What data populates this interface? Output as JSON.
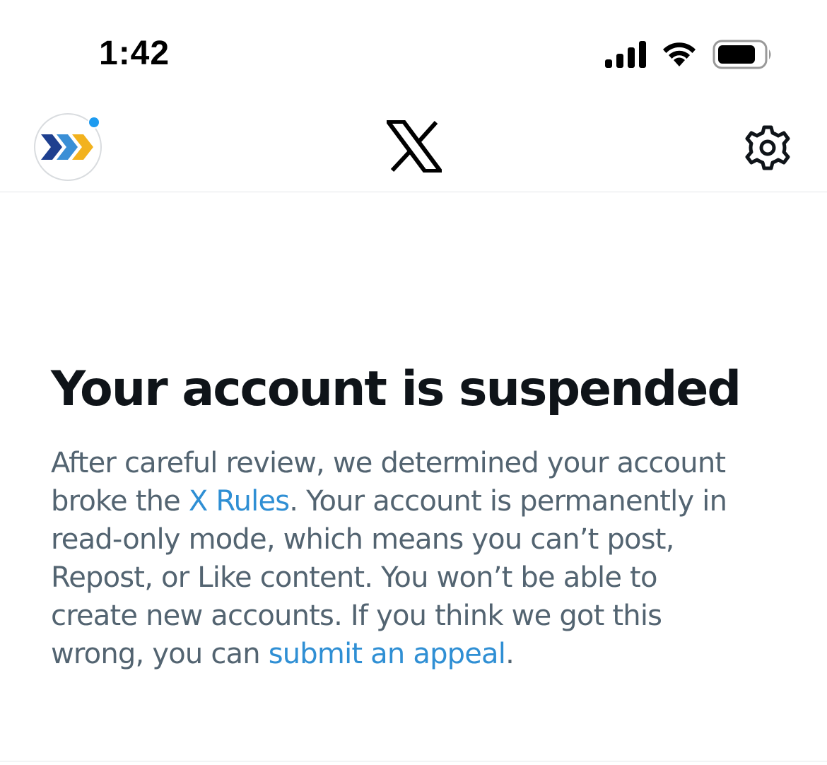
{
  "status_bar": {
    "time": "1:42"
  },
  "header": {
    "logo_letter": "X",
    "avatar_icon": "profile-avatar-chevrons",
    "settings_icon": "gear-icon"
  },
  "suspension": {
    "title": "Your account is suspended",
    "line1": "After careful review, we determined your account",
    "line2_pre": "broke the ",
    "rules_link": "X Rules",
    "line2_post": ". Your account is permanently in",
    "line3": "read-only mode, which means you can’t post,",
    "line4": "Repost, or Like content. You won’t be able to",
    "line5": "create new accounts. If you think we got this",
    "line6_pre": "wrong, you can ",
    "appeal_link": "submit an appeal",
    "line6_post": "."
  },
  "colors": {
    "link": "#2f8fd4",
    "body_text": "#536471",
    "title_text": "#0f1419",
    "notification_dot": "#1d9bf0"
  }
}
